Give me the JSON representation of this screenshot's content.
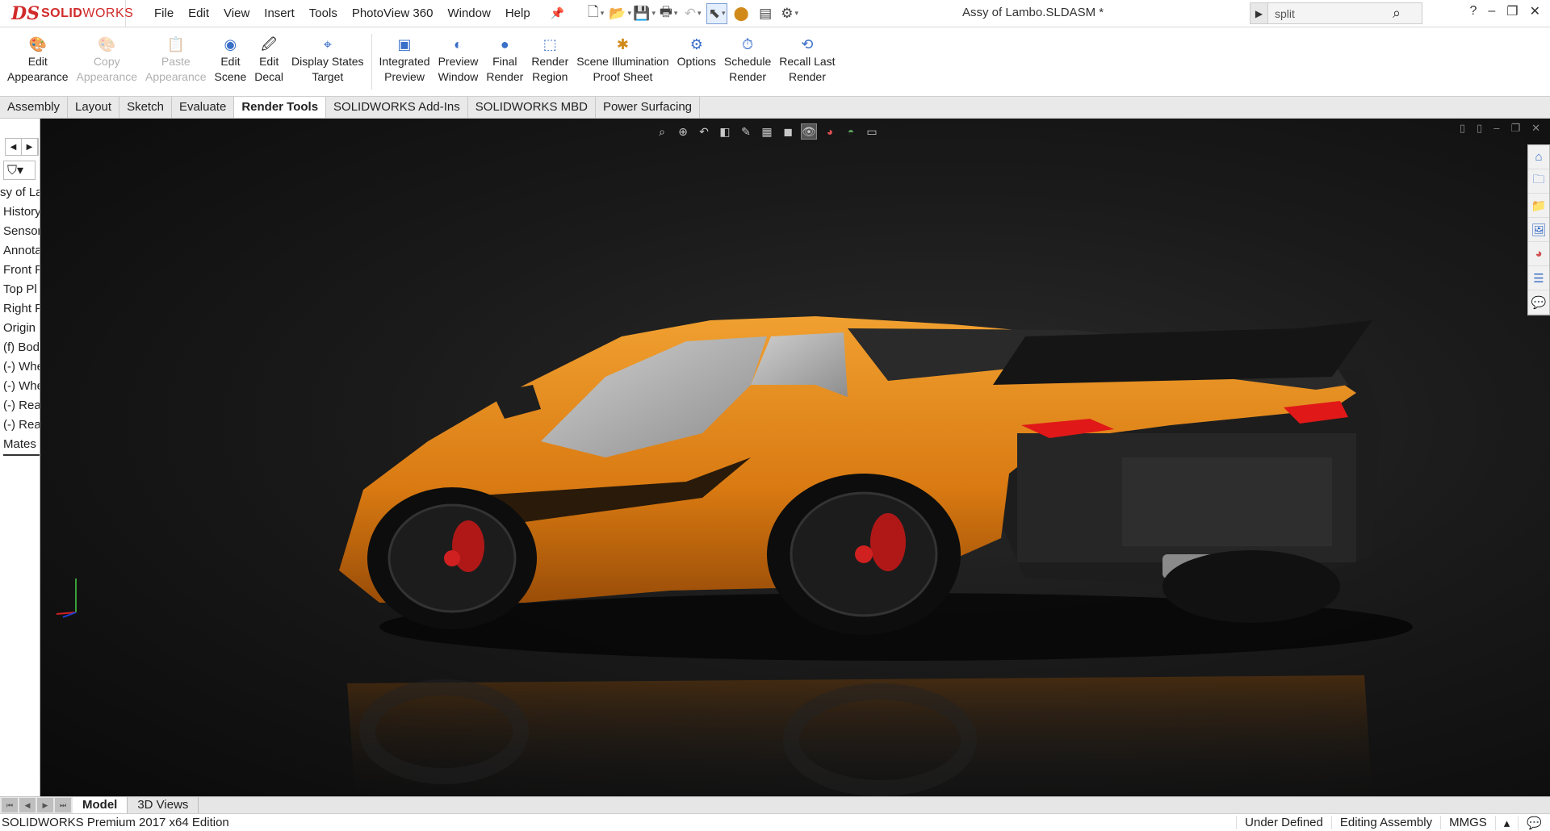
{
  "app": {
    "logo_ds": "DS",
    "logo_name_bold": "SOLID",
    "logo_name": "WORKS",
    "document_title": "Assy of Lambo.SLDASM *"
  },
  "menu": [
    "File",
    "Edit",
    "View",
    "Insert",
    "Tools",
    "PhotoView 360",
    "Window",
    "Help"
  ],
  "search": {
    "value": "split",
    "placeholder": ""
  },
  "ribbon": [
    {
      "line1": "Edit",
      "line2": "Appearance",
      "icon": "edit-appearance-icon",
      "enabled": true
    },
    {
      "line1": "Copy",
      "line2": "Appearance",
      "icon": "copy-appearance-icon",
      "enabled": false
    },
    {
      "line1": "Paste",
      "line2": "Appearance",
      "icon": "paste-appearance-icon",
      "enabled": false
    },
    {
      "line1": "Edit",
      "line2": "Scene",
      "icon": "edit-scene-icon",
      "enabled": true
    },
    {
      "line1": "Edit",
      "line2": "Decal",
      "icon": "edit-decal-icon",
      "enabled": true
    },
    {
      "line1": "Display States",
      "line2": "Target",
      "icon": "display-states-icon",
      "enabled": true
    },
    {
      "line1": "Integrated",
      "line2": "Preview",
      "icon": "integrated-preview-icon",
      "enabled": true
    },
    {
      "line1": "Preview",
      "line2": "Window",
      "icon": "preview-window-icon",
      "enabled": true
    },
    {
      "line1": "Final",
      "line2": "Render",
      "icon": "final-render-icon",
      "enabled": true
    },
    {
      "line1": "Render",
      "line2": "Region",
      "icon": "render-region-icon",
      "enabled": true
    },
    {
      "line1": "Scene Illumination",
      "line2": "Proof Sheet",
      "icon": "scene-illumination-icon",
      "enabled": true
    },
    {
      "line1": "Options",
      "line2": "",
      "icon": "options-icon",
      "enabled": true
    },
    {
      "line1": "Schedule",
      "line2": "Render",
      "icon": "schedule-render-icon",
      "enabled": true
    },
    {
      "line1": "Recall Last",
      "line2": "Render",
      "icon": "recall-render-icon",
      "enabled": true
    }
  ],
  "tabs": [
    "Assembly",
    "Layout",
    "Sketch",
    "Evaluate",
    "Render Tools",
    "SOLIDWORKS Add-Ins",
    "SOLIDWORKS MBD",
    "Power Surfacing"
  ],
  "active_tab": "Render Tools",
  "tree": [
    "sy of La",
    "History",
    "Sensor",
    "Annota",
    "Front P",
    "Top Pl",
    "Right F",
    "Origin",
    "(f) Bod",
    "(-) Whe",
    "(-) Whe",
    "(-) Rea",
    "(-) Rea",
    "Mates"
  ],
  "bottom_tabs": [
    "Model",
    "3D Views"
  ],
  "active_bottom_tab": "Model",
  "status": {
    "edition": "SOLIDWORKS Premium 2017 x64 Edition",
    "definition": "Under Defined",
    "mode": "Editing Assembly",
    "units": "MMGS"
  },
  "colors": {
    "car_body": "#e68a1a",
    "taillight": "#e01818",
    "background": "#141414",
    "accent": "#3a6fc8"
  }
}
